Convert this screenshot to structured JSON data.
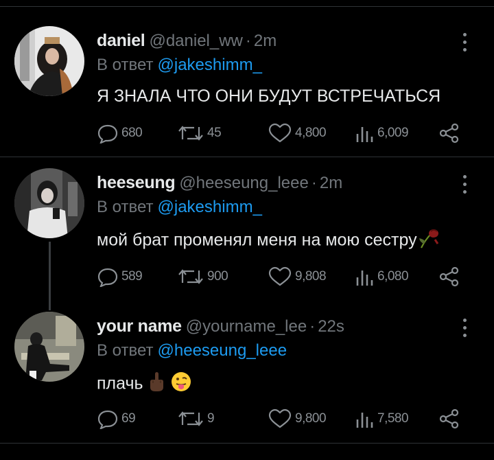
{
  "tweets": [
    {
      "display_name": "daniel",
      "handle": "@daniel_ww",
      "separator": "·",
      "time": "2m",
      "reply_prefix": "В ответ",
      "reply_to": "@jakeshimm_",
      "text": "Я ЗНАЛА ЧТО ОНИ БУДУТ ВСТРЕЧАТЬСЯ",
      "emoji": [],
      "replies": "680",
      "retweets": "45",
      "likes": "4,800",
      "views": "6,009"
    },
    {
      "display_name": "heeseung",
      "handle": "@heeseung_leee",
      "separator": "·",
      "time": "2m",
      "reply_prefix": "В ответ",
      "reply_to": "@jakeshimm_",
      "text": "мой брат променял меня на мою сестру",
      "emoji": [
        "wilted-rose"
      ],
      "replies": "589",
      "retweets": "900",
      "likes": "9,808",
      "views": "6,080"
    },
    {
      "display_name": "your name",
      "handle": "@yourname_lee",
      "separator": "·",
      "time": "22s",
      "reply_prefix": "В ответ",
      "reply_to": "@heeseung_leee",
      "text": "плачь",
      "emoji": [
        "middle-finger-dark",
        "tongue-face"
      ],
      "replies": "69",
      "retweets": "9",
      "likes": "9,800",
      "views": "7,580"
    }
  ],
  "colors": {
    "background": "#000000",
    "text": "#e7e9ea",
    "muted": "#71767b",
    "link": "#1d9bf0",
    "divider": "#2f3336"
  },
  "icons": [
    "reply-icon",
    "retweet-icon",
    "like-icon",
    "views-icon",
    "share-icon",
    "more-icon"
  ]
}
